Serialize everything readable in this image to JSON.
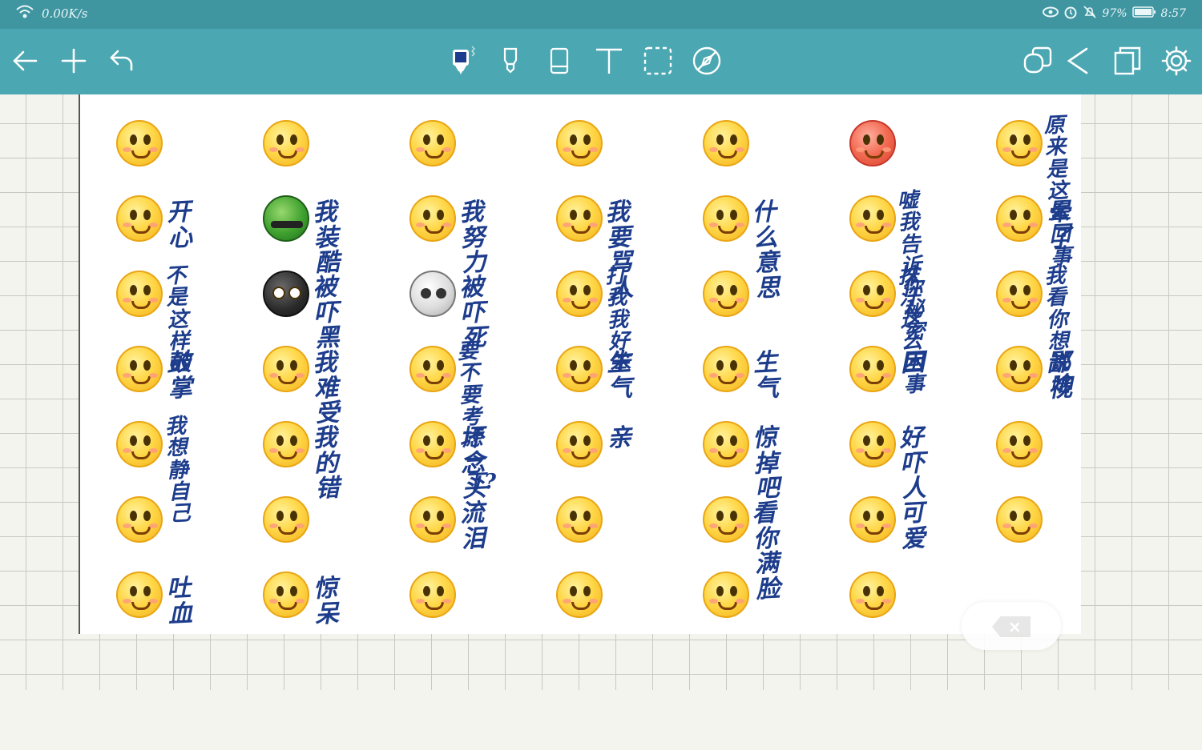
{
  "status_bar": {
    "net_speed": "0.00K/s",
    "battery": "97%",
    "time": "8:57"
  },
  "toolbar": {
    "left_icons": [
      "back-arrow-icon",
      "add-icon",
      "undo-icon"
    ],
    "center_tools": [
      "pen-tool",
      "highlighter-tool",
      "eraser-tool",
      "text-tool",
      "lasso-select-tool",
      "disable-stylus-tool"
    ],
    "right_icons": [
      "layers-icon",
      "share-icon",
      "pages-icon",
      "settings-icon"
    ],
    "active_pen_color": "#1d3d8c"
  },
  "notes": [
    {
      "emoji": "smile",
      "text": ""
    },
    {
      "emoji": "surprised",
      "text": ""
    },
    {
      "emoji": "confused",
      "text": ""
    },
    {
      "emoji": "tongue",
      "text": ""
    },
    {
      "emoji": "unamused",
      "text": ""
    },
    {
      "emoji": "angry-red",
      "text": ""
    },
    {
      "emoji": "sweat",
      "text": "原来是这么\n回事"
    },
    {
      "emoji": "laugh",
      "text": "开心"
    },
    {
      "emoji": "cool-green",
      "text": "我装酷"
    },
    {
      "emoji": "headband",
      "text": "我努力"
    },
    {
      "emoji": "yell",
      "text": "我要骂人"
    },
    {
      "emoji": "question",
      "text": "什么意思"
    },
    {
      "emoji": "shush",
      "text": "嘘我告诉\n你秘密"
    },
    {
      "emoji": "dizzy",
      "text": "晕了"
    },
    {
      "emoji": "cry",
      "text": "不是这样\n的"
    },
    {
      "emoji": "black-ghost",
      "text": "被吓黑"
    },
    {
      "emoji": "skull",
      "text": "被吓死"
    },
    {
      "emoji": "hammer",
      "text": "打我我\n好笨"
    },
    {
      "emoji": "cheek",
      "text": ""
    },
    {
      "emoji": "sweat-wipe",
      "text": "抹汗\n这么回事"
    },
    {
      "emoji": "pick-nose",
      "text": "我看你\n想说啥"
    },
    {
      "emoji": "clap",
      "text": "鼓掌"
    },
    {
      "emoji": "teary",
      "text": "我难受"
    },
    {
      "emoji": "grin",
      "text": "要不要\n考虑一下?"
    },
    {
      "emoji": "side-eye",
      "text": "生气"
    },
    {
      "emoji": "side-eye2",
      "text": "生气"
    },
    {
      "emoji": "yawn",
      "text": "困"
    },
    {
      "emoji": "disdain",
      "text": "鄙视"
    },
    {
      "emoji": "sad-cover",
      "text": "我想静\n自己"
    },
    {
      "emoji": "sad",
      "text": "我的错"
    },
    {
      "emoji": "smirk",
      "text": "坏念头"
    },
    {
      "emoji": "kiss",
      "text": "亲"
    },
    {
      "emoji": "shock",
      "text": "惊掉吧"
    },
    {
      "emoji": "scared",
      "text": "好吓人"
    },
    {
      "emoji": "wink-tongue",
      "text": ""
    },
    {
      "emoji": "lol-cry",
      "text": ""
    },
    {
      "emoji": "pout",
      "text": ""
    },
    {
      "emoji": "tears",
      "text": "流泪"
    },
    {
      "emoji": "shy",
      "text": ""
    },
    {
      "emoji": "think",
      "text": "看你满脸"
    },
    {
      "emoji": "hmph",
      "text": "可爱"
    },
    {
      "emoji": "wide-grin",
      "text": ""
    },
    {
      "emoji": "nosebleed",
      "text": "吐血"
    },
    {
      "emoji": "astonished",
      "text": "惊呆"
    },
    {
      "emoji": "point",
      "text": ""
    },
    {
      "emoji": "blush",
      "text": ""
    },
    {
      "emoji": "cheeks-hands",
      "text": ""
    },
    {
      "emoji": "mask",
      "text": ""
    }
  ]
}
